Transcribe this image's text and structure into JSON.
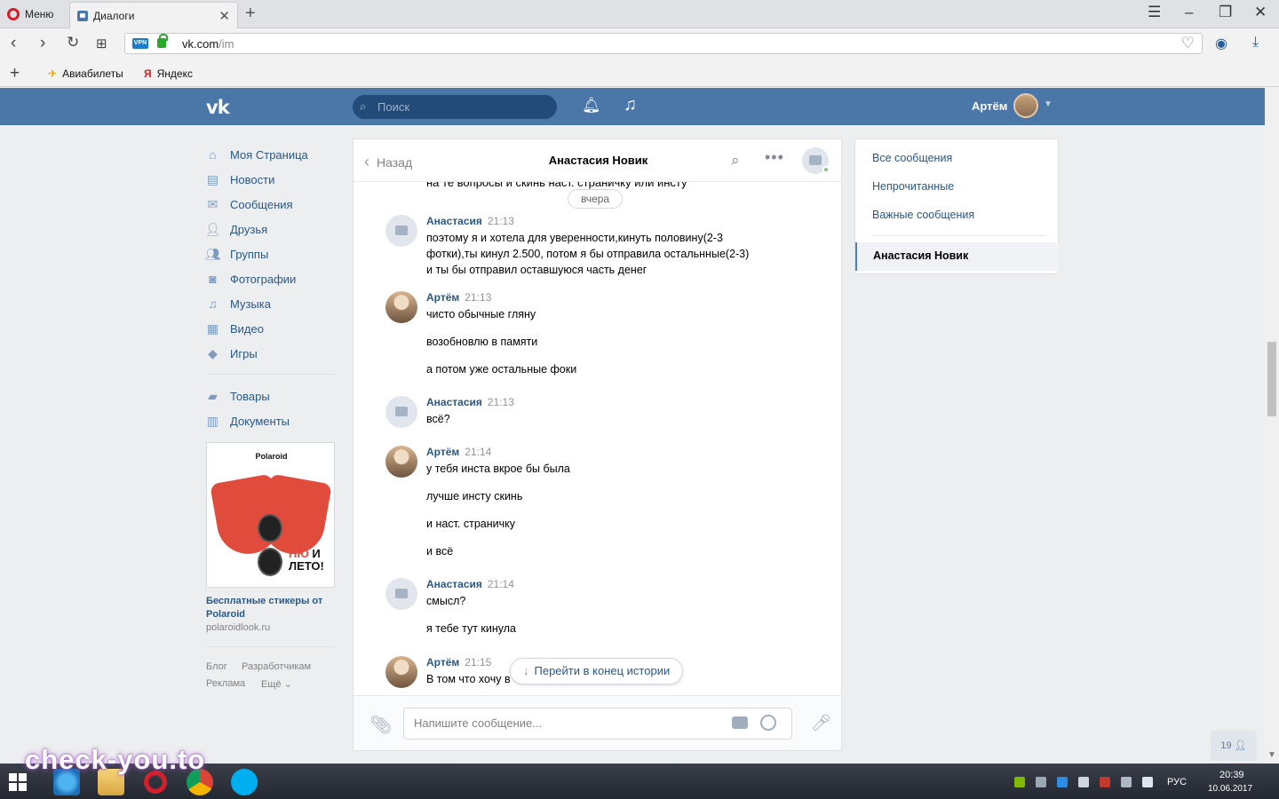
{
  "browser": {
    "menu_label": "Меню",
    "tab_title": "Диалоги",
    "vpn_badge": "VPN",
    "url_host": "vk.com",
    "url_path": "/im",
    "bookmarks": [
      "Авиабилеты",
      "Яндекс"
    ]
  },
  "header": {
    "logo": "vk",
    "search_placeholder": "Поиск",
    "user_name": "Артём"
  },
  "left_menu": {
    "items": [
      {
        "label": "Моя Страница",
        "icon": "home-icon"
      },
      {
        "label": "Новости",
        "icon": "news-icon"
      },
      {
        "label": "Сообщения",
        "icon": "messages-icon"
      },
      {
        "label": "Друзья",
        "icon": "friends-icon"
      },
      {
        "label": "Группы",
        "icon": "groups-icon"
      },
      {
        "label": "Фотографии",
        "icon": "photos-icon"
      },
      {
        "label": "Музыка",
        "icon": "music-icon"
      },
      {
        "label": "Видео",
        "icon": "video-icon"
      },
      {
        "label": "Игры",
        "icon": "games-icon"
      }
    ],
    "items2": [
      {
        "label": "Товары",
        "icon": "goods-icon"
      },
      {
        "label": "Документы",
        "icon": "documents-icon"
      }
    ]
  },
  "ad": {
    "brand": "Polaroid",
    "tag_line1": "НЮ",
    "tag_and": "И",
    "tag_line2": "ЛЕТО!",
    "title": "Бесплатные стикеры от Polaroid",
    "url": "polaroidlook.ru"
  },
  "footer": {
    "blog": "Блог",
    "developers": "Разработчикам",
    "ads": "Реклама",
    "more": "Ещё"
  },
  "chat": {
    "back_label": "Назад",
    "peer_name": "Анастасия Новик",
    "cut_line": "на те вопросы и скинь наст. страничку или инсту",
    "date_divider": "вчера",
    "groups": [
      {
        "author": "Анастасия",
        "time": "21:13",
        "avatar": "camera-stub",
        "lines": [
          "поэтому я и хотела для уверенности,кинуть половину(2-3",
          "фотки),ты кинул 2.500, потом я бы отправила остальнные(2-3)",
          "и ты бы отправил оставшуюся часть денег"
        ]
      },
      {
        "author": "Артём",
        "time": "21:13",
        "avatar": "photo",
        "lines": [
          "чисто обычные гляну",
          "возобновлю в памяти",
          "а потом уже остальные фоки"
        ]
      },
      {
        "author": "Анастасия",
        "time": "21:13",
        "avatar": "camera-stub",
        "lines": [
          "всё?"
        ]
      },
      {
        "author": "Артём",
        "time": "21:14",
        "avatar": "photo",
        "lines": [
          "у тебя инста вкрое бы была",
          "лучше инсту скинь",
          "и наст. страничку",
          "и всё"
        ]
      },
      {
        "author": "Анастасия",
        "time": "21:14",
        "avatar": "camera-stub",
        "lines": [
          "смысл?",
          "я тебе тут кинула"
        ]
      },
      {
        "author": "Артём",
        "time": "21:15",
        "avatar": "photo",
        "lines": [
          "В том что хочу в"
        ]
      }
    ],
    "jump_label": "Перейти в конец истории",
    "input_placeholder": "Напишите сообщение..."
  },
  "right_panel": {
    "all": "Все сообщения",
    "unread": "Непрочитанные",
    "important": "Важные сообщения",
    "active_dialog": "Анастасия Новик"
  },
  "page_badge": "19",
  "taskbar": {
    "lang": "РУС",
    "time": "20:39",
    "date": "10.06.2017"
  },
  "watermark": "check-you.to",
  "colors": {
    "vk_blue": "#4a76a8",
    "link": "#2a5885",
    "page_bg": "#edeef0"
  }
}
